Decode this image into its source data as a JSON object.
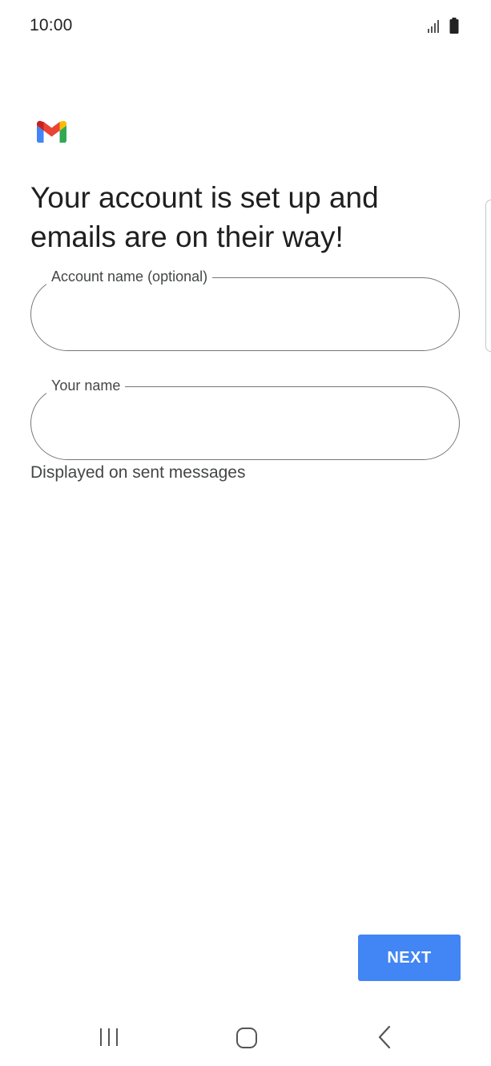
{
  "status_bar": {
    "time": "10:00",
    "icons": [
      "signal-icon",
      "battery-icon"
    ]
  },
  "app": {
    "logo": "gmail-logo-icon",
    "logo_colors": {
      "blue": "#4285f4",
      "red": "#ea4335",
      "yellow": "#fbbc04",
      "green": "#34a853",
      "dark_red": "#c5221f"
    }
  },
  "title": "Your account is set up and emails are on their way!",
  "fields": {
    "account_name": {
      "label": "Account name (optional)",
      "value": "",
      "placeholder": ""
    },
    "your_name": {
      "label": "Your name",
      "value": "",
      "placeholder": "",
      "helper": "Displayed on sent messages"
    }
  },
  "buttons": {
    "next_label": "NEXT",
    "accent_color": "#4285f4"
  },
  "nav_bar": {
    "items": [
      "recent-apps-icon",
      "home-icon",
      "back-icon"
    ]
  }
}
